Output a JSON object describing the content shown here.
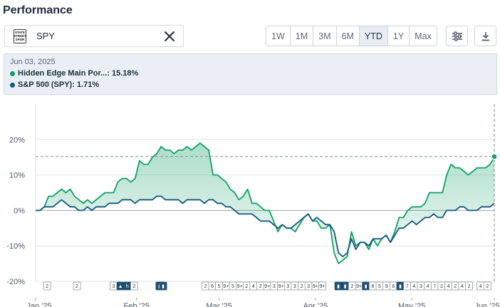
{
  "header": {
    "title": "Performance"
  },
  "symbol": {
    "logo_lines": [
      "STATE",
      "STREET",
      "SPDR"
    ],
    "value": "SPY"
  },
  "ranges": [
    {
      "label": "1W",
      "active": false
    },
    {
      "label": "1M",
      "active": false
    },
    {
      "label": "3M",
      "active": false
    },
    {
      "label": "6M",
      "active": false
    },
    {
      "label": "YTD",
      "active": true
    },
    {
      "label": "1Y",
      "active": false
    },
    {
      "label": "Max",
      "active": false
    }
  ],
  "tooltip": {
    "date": "Jun 03, 2025",
    "rows": [
      {
        "label": "Hidden Edge Main Por...: 15.18%",
        "color": "#11a064"
      },
      {
        "label": "S&P 500 (SPY): 1.71%",
        "color": "#14577d"
      }
    ]
  },
  "colors": {
    "portfolio": "#11a064",
    "spy": "#14577d"
  },
  "chart_data": {
    "type": "line",
    "ylim": [
      -20,
      30
    ],
    "yticks": [
      "20%",
      "10%",
      "0%",
      "-10%",
      "-20%"
    ],
    "ytick_values": [
      20,
      10,
      0,
      -10,
      -20
    ],
    "xlabels": [
      "Jan '25",
      "Feb '25",
      "Mar '25",
      "Apr '25",
      "May '25",
      "Jun '25"
    ],
    "xlabel_positions": [
      0,
      22,
      40,
      61,
      82,
      100
    ],
    "series": [
      {
        "name": "Hidden Edge Main Portfolio",
        "values": [
          0,
          0,
          1,
          4,
          4,
          5,
          6,
          5,
          6,
          4,
          3,
          2,
          3,
          2,
          3,
          4,
          5,
          5,
          5,
          8,
          9,
          9,
          8,
          9,
          14,
          13,
          13,
          15,
          16,
          18,
          17,
          17,
          16,
          17,
          17,
          18,
          17,
          18,
          19,
          18,
          17,
          10,
          10,
          9,
          8,
          6,
          5,
          3,
          4,
          6,
          2,
          2,
          1,
          0,
          0,
          -3,
          -6,
          -4,
          -5,
          -5,
          -6,
          -4,
          -2,
          -1,
          -3,
          -3,
          -5,
          -5,
          -4,
          -12,
          -15,
          -14,
          -13,
          -6,
          -10,
          -9,
          -9,
          -11,
          -8,
          -10,
          -8,
          -7,
          -9,
          -6,
          -2,
          -2,
          0,
          1,
          1,
          1,
          2,
          5,
          5,
          5,
          5,
          10,
          13,
          12,
          12,
          11,
          10,
          11,
          12,
          12,
          12,
          13,
          15
        ],
        "color": "#11a064"
      },
      {
        "name": "S&P 500 (SPY)",
        "values": [
          0,
          0,
          1,
          1,
          1,
          2,
          3,
          2,
          1,
          1,
          0,
          0,
          1,
          0,
          1,
          1,
          1,
          2,
          2,
          2,
          3,
          3,
          3,
          2,
          3,
          3,
          3,
          3,
          4,
          4,
          3,
          3,
          3,
          3,
          2,
          3,
          3,
          3,
          3,
          2,
          3,
          3,
          2,
          2,
          1,
          1,
          0,
          -1,
          -1,
          -1,
          -1,
          -2,
          -3,
          -3,
          -3,
          -4,
          -5,
          -4,
          -5,
          -5,
          -4,
          -3,
          -2,
          -1,
          -3,
          -2,
          -3,
          -4,
          -4,
          -6,
          -12,
          -13,
          -12,
          -8,
          -11,
          -9,
          -9,
          -10,
          -8,
          -8,
          -8,
          -7,
          -9,
          -7,
          -5,
          -5,
          -4,
          -3,
          -4,
          -3,
          -2,
          -2,
          -1,
          -2,
          -2,
          0,
          0,
          0,
          1,
          1,
          0,
          0,
          0,
          1,
          1,
          1,
          2
        ],
        "color": "#14577d"
      }
    ],
    "events": {
      "x_percent": [
        2.5,
        9,
        17,
        18.5,
        20,
        21.5,
        27,
        27.8,
        37,
        38.5,
        40,
        41.5,
        43,
        44.5,
        46,
        47.5,
        49,
        50.5,
        52,
        53.5,
        55,
        56.5,
        58,
        59.5,
        61,
        62.5,
        66,
        67.5,
        69,
        70.5,
        72,
        73.5,
        75,
        76.5,
        78,
        79.5,
        81,
        82.5,
        84,
        85.5,
        87,
        88.5,
        90,
        91.5,
        93,
        94.5,
        97,
        98.5
      ],
      "labels": [
        "2",
        "2",
        "3",
        "▲",
        "h",
        "2",
        "▮",
        "▮",
        "2",
        "6",
        "5",
        "9+",
        "5",
        "9+",
        "2",
        "4",
        "2",
        "9+",
        "3",
        "9+",
        "3",
        "3",
        "2",
        "3",
        "9+",
        "9+",
        "▮",
        "▮",
        "2",
        "9+",
        "▮",
        "8",
        "5",
        "9",
        "6",
        "▮",
        "7",
        "4",
        "3",
        "4",
        "7",
        "2",
        "4",
        "2",
        "4",
        "2",
        "4",
        "2"
      ],
      "highlight": [
        false,
        false,
        false,
        true,
        true,
        false,
        true,
        true,
        false,
        false,
        false,
        false,
        false,
        false,
        false,
        false,
        false,
        false,
        false,
        false,
        false,
        false,
        false,
        false,
        false,
        false,
        true,
        true,
        false,
        false,
        true,
        false,
        false,
        false,
        false,
        true,
        false,
        false,
        false,
        false,
        false,
        false,
        false,
        false,
        false,
        false,
        false,
        false
      ]
    },
    "current_value_percent": 15.18,
    "legend": "none",
    "grid": true
  }
}
